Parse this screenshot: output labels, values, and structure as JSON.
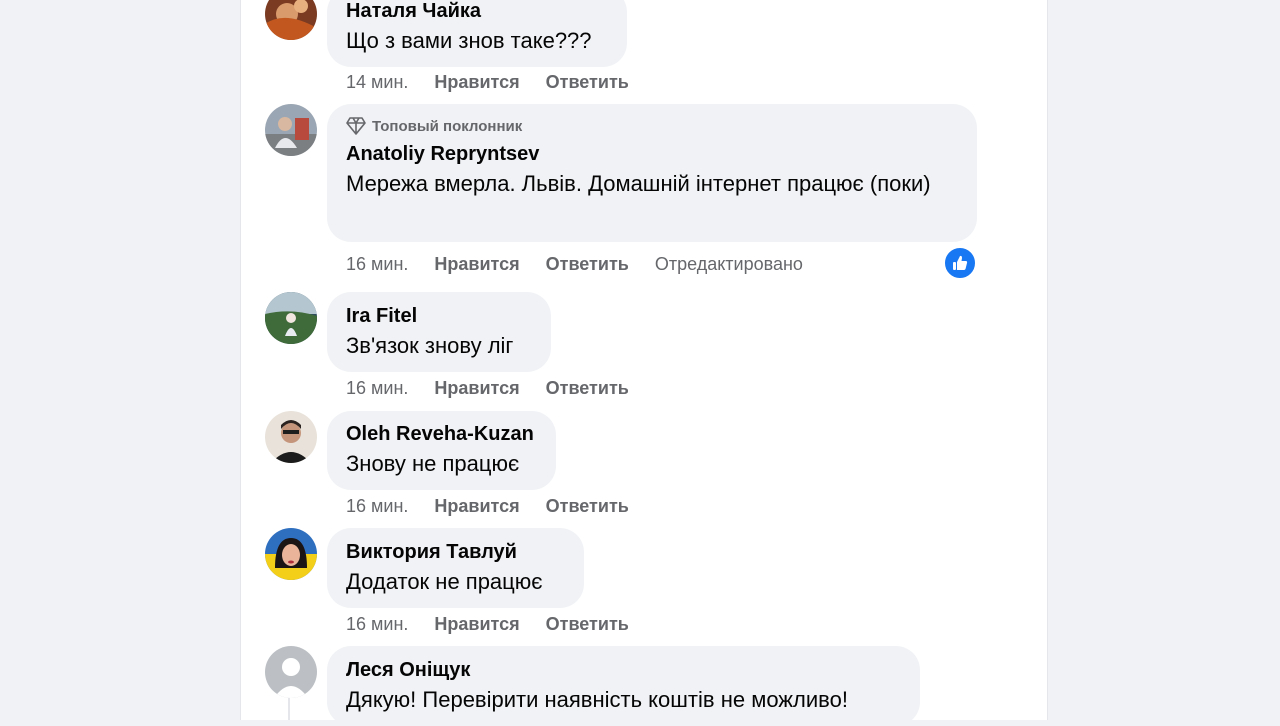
{
  "comments": [
    {
      "author": "Наталя Чайка",
      "badge": "",
      "text": "Що з вами знов таке???",
      "time": "14 мин.",
      "like": "Нравится",
      "reply": "Ответить",
      "edited": ""
    },
    {
      "author": "Anatoliy Repryntsev",
      "badge": "Топовый поклонник",
      "text": "Мережа вмерла. Львів. Домашній інтернет працює (поки)",
      "time": "16 мин.",
      "like": "Нравится",
      "reply": "Ответить",
      "edited": "Отредактировано",
      "reaction": "like"
    },
    {
      "author": "Ira Fitel",
      "badge": "",
      "text": "Зв'язок знову ліг",
      "time": "16 мин.",
      "like": "Нравится",
      "reply": "Ответить",
      "edited": ""
    },
    {
      "author": "Oleh Reveha-Kuzan",
      "badge": "",
      "text": "Знову не працює",
      "time": "16 мин.",
      "like": "Нравится",
      "reply": "Ответить",
      "edited": ""
    },
    {
      "author": "Виктория Тавлуй",
      "badge": "",
      "text": "Додаток не працює",
      "time": "16 мин.",
      "like": "Нравится",
      "reply": "Ответить",
      "edited": ""
    },
    {
      "author": "Леся Оніщук",
      "badge": "",
      "text": "Дякую! Перевірити наявність коштів не можливо!",
      "time": "",
      "like": "",
      "reply": "",
      "edited": ""
    }
  ],
  "colors": {
    "background": "#f0f2f5",
    "bubble": "#f0f2f5",
    "text": "#050505",
    "secondary": "#65676b",
    "accent": "#1877f2"
  }
}
